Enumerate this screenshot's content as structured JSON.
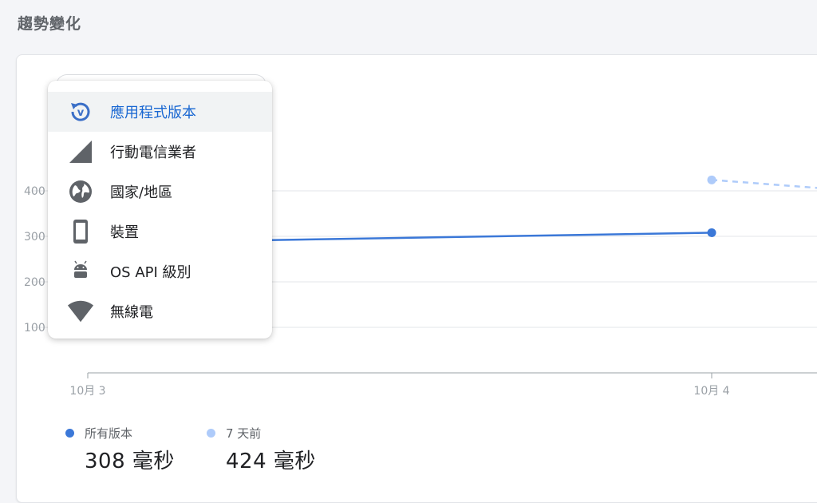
{
  "section_title": "趨勢變化",
  "menu": {
    "items": [
      {
        "label": "應用程式版本",
        "icon": "app-version-icon",
        "selected": true
      },
      {
        "label": "行動電信業者",
        "icon": "signal-icon",
        "selected": false
      },
      {
        "label": "國家/地區",
        "icon": "globe-icon",
        "selected": false
      },
      {
        "label": "裝置",
        "icon": "phone-icon",
        "selected": false
      },
      {
        "label": "OS API 級別",
        "icon": "android-icon",
        "selected": false
      },
      {
        "label": "無線電",
        "icon": "wifi-icon",
        "selected": false
      }
    ]
  },
  "chart_data": {
    "type": "line",
    "x": [
      "10月 3",
      "10月 4"
    ],
    "yticks": [
      "100",
      "200",
      "300",
      "400"
    ],
    "series": [
      {
        "name": "所有版本",
        "values": [
          285,
          308
        ],
        "color": "#3b78d8",
        "style": "solid"
      },
      {
        "name": "7 天前",
        "values": [
          null,
          424
        ],
        "color": "#aecbfa",
        "style": "dashed"
      }
    ]
  },
  "legend": [
    {
      "label": "所有版本",
      "value": "308 毫秒",
      "color": "#3b78d8"
    },
    {
      "label": "7 天前",
      "value": "424 毫秒",
      "color": "#aecbfa"
    }
  ],
  "colors": {
    "accent": "#1967d2",
    "icon": "#5f6368"
  }
}
